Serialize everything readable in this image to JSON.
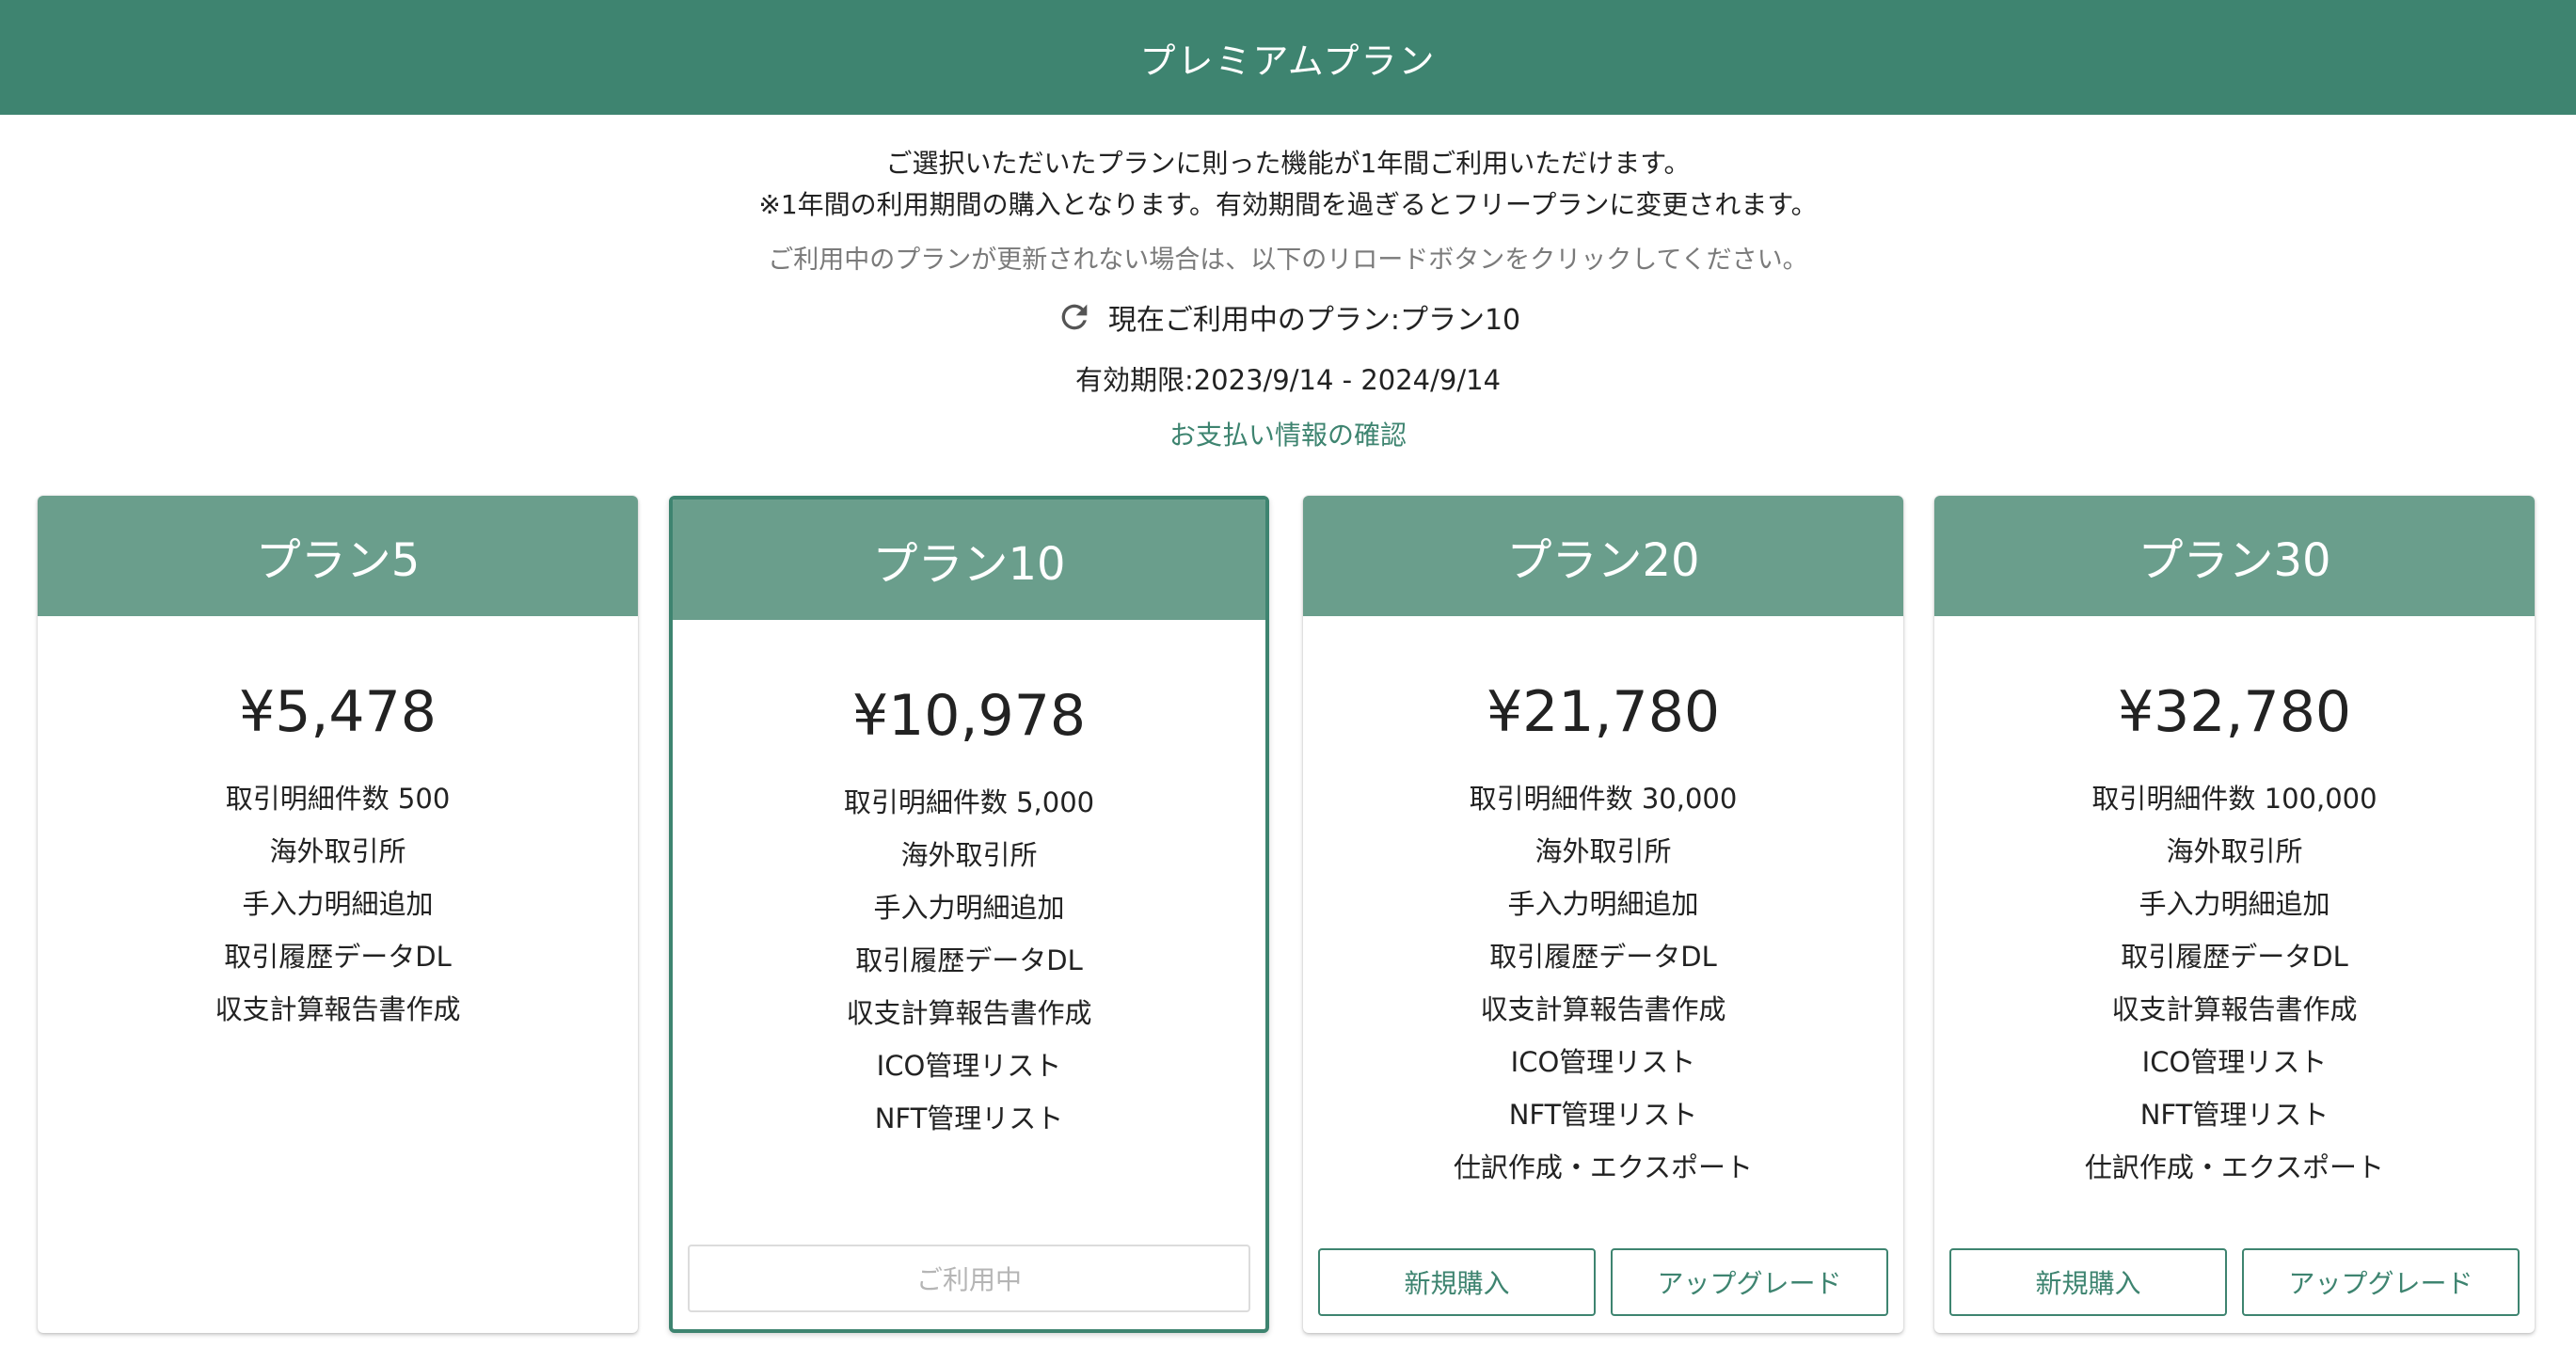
{
  "header": {
    "title": "プレミアムプラン"
  },
  "info": {
    "line1": "ご選択いただいたプランに則った機能が1年間ご利用いただけます。",
    "line2": "※1年間の利用期間の購入となります。有効期間を過ぎるとフリープランに変更されます。",
    "reload_note": "ご利用中のプランが更新されない場合は、以下のリロードボタンをクリックしてください。",
    "current_plan": "現在ご利用中のプラン:プラン10",
    "expiry": "有効期限:2023/9/14 - 2024/9/14",
    "payment_link": "お支払い情報の確認",
    "reload_icon": "reload-icon"
  },
  "colors": {
    "header": "#3e8470",
    "card_head": "#6a9e8c",
    "accent": "#3e8470"
  },
  "plans": [
    {
      "title": "プラン5",
      "price": "¥5,478",
      "features": [
        "取引明細件数 500",
        "海外取引所",
        "手入力明細追加",
        "取引履歴データDL",
        "収支計算報告書作成"
      ],
      "active": false
    },
    {
      "title": "プラン10",
      "price": "¥10,978",
      "features": [
        "取引明細件数 5,000",
        "海外取引所",
        "手入力明細追加",
        "取引履歴データDL",
        "収支計算報告書作成",
        "ICO管理リスト",
        "NFT管理リスト"
      ],
      "active": true,
      "current_label": "ご利用中"
    },
    {
      "title": "プラン20",
      "price": "¥21,780",
      "features": [
        "取引明細件数 30,000",
        "海外取引所",
        "手入力明細追加",
        "取引履歴データDL",
        "収支計算報告書作成",
        "ICO管理リスト",
        "NFT管理リスト",
        "仕訳作成・エクスポート"
      ],
      "active": false,
      "buy_label": "新規購入",
      "upgrade_label": "アップグレード"
    },
    {
      "title": "プラン30",
      "price": "¥32,780",
      "features": [
        "取引明細件数 100,000",
        "海外取引所",
        "手入力明細追加",
        "取引履歴データDL",
        "収支計算報告書作成",
        "ICO管理リスト",
        "NFT管理リスト",
        "仕訳作成・エクスポート"
      ],
      "active": false,
      "buy_label": "新規購入",
      "upgrade_label": "アップグレード"
    }
  ]
}
